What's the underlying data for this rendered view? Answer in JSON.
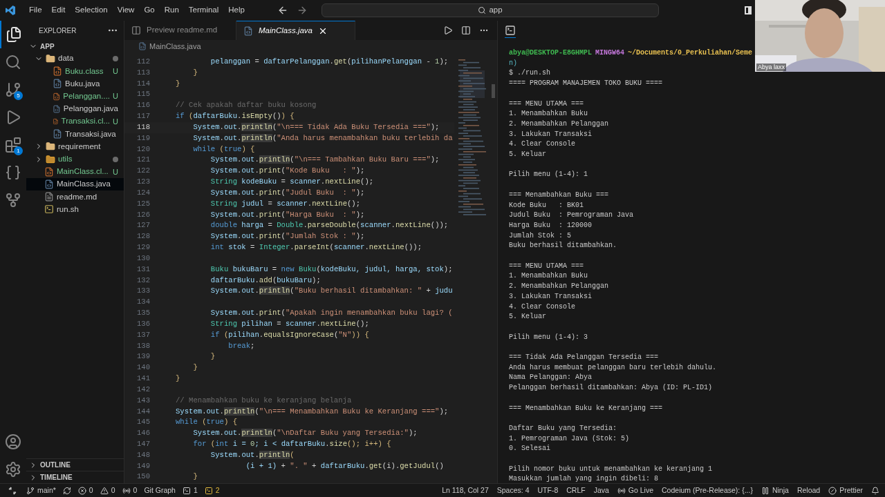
{
  "menu": [
    "File",
    "Edit",
    "Selection",
    "View",
    "Go",
    "Run",
    "Terminal",
    "Help"
  ],
  "search": {
    "value": "app"
  },
  "activity": [
    {
      "kind": "files",
      "selected": true
    },
    {
      "kind": "search",
      "selected": false
    },
    {
      "kind": "scm",
      "selected": false,
      "badge": "5"
    },
    {
      "kind": "debug",
      "selected": false
    },
    {
      "kind": "extensions",
      "selected": false,
      "badge": "1"
    },
    {
      "kind": "braces",
      "selected": false
    },
    {
      "kind": "graph",
      "selected": false
    }
  ],
  "explorer": {
    "title": "EXPLORER",
    "root": "APP",
    "items": [
      {
        "name": "data",
        "kind": "folder",
        "expanded": true,
        "modified": true,
        "untracked": false,
        "selected": false,
        "children": [
          {
            "name": "Buku.class",
            "kind": "class",
            "untracked": true,
            "status": "U",
            "selected": false
          },
          {
            "name": "Buku.java",
            "kind": "java",
            "untracked": false,
            "selected": false
          },
          {
            "name": "Pelanggan....",
            "kind": "class",
            "untracked": true,
            "status": "U",
            "selected": false
          },
          {
            "name": "Pelanggan.java",
            "kind": "java",
            "untracked": false,
            "selected": false
          },
          {
            "name": "Transaksi.cl...",
            "kind": "class",
            "untracked": true,
            "status": "U",
            "selected": false
          },
          {
            "name": "Transaksi.java",
            "kind": "java",
            "untracked": false,
            "selected": false
          }
        ]
      },
      {
        "name": "requirement",
        "kind": "folder",
        "expanded": false,
        "modified": false,
        "untracked": false,
        "selected": false
      },
      {
        "name": "utils",
        "kind": "tools-folder",
        "expanded": false,
        "modified": true,
        "untracked": true,
        "selected": false
      },
      {
        "name": "MainClass.cl...",
        "kind": "class",
        "untracked": true,
        "status": "U",
        "selected": false
      },
      {
        "name": "MainClass.java",
        "kind": "java",
        "untracked": false,
        "selected": true
      },
      {
        "name": "readme.md",
        "kind": "markdown",
        "untracked": false,
        "selected": false
      },
      {
        "name": "run.sh",
        "kind": "shell",
        "untracked": false,
        "selected": false
      }
    ],
    "sections": [
      "OUTLINE",
      "TIMELINE"
    ]
  },
  "tabs": [
    {
      "label": "Preview readme.md",
      "kind": "preview",
      "selected": false
    },
    {
      "label": "MainClass.java",
      "kind": "java",
      "selected": true
    }
  ],
  "breadcrumb": "MainClass.java",
  "code": [
    {
      "n": "112",
      "active": false,
      "t": [
        {
          "text": "        pelanggan",
          "kind": "v"
        },
        {
          "text": " = ",
          "kind": "p"
        },
        {
          "text": "daftarPelanggan",
          "kind": "v"
        },
        {
          "text": ".",
          "kind": "p"
        },
        {
          "text": "get",
          "kind": "f"
        },
        {
          "text": "(",
          "kind": "p"
        },
        {
          "text": "pilihanPelanggan",
          "kind": "v"
        },
        {
          "text": " - ",
          "kind": "p"
        },
        {
          "text": "1",
          "kind": "n"
        },
        {
          "text": ");",
          "kind": "p"
        }
      ]
    },
    {
      "n": "113",
      "active": false,
      "t": [
        {
          "text": "    }",
          "kind": "b"
        }
      ]
    },
    {
      "n": "114",
      "active": false,
      "t": [
        {
          "text": "}",
          "kind": "b"
        }
      ]
    },
    {
      "n": "115",
      "active": false
    },
    {
      "n": "116",
      "active": false,
      "t": [
        {
          "text": "// Cek apakah daftar buku kosong",
          "kind": "m"
        }
      ]
    },
    {
      "n": "117",
      "active": false,
      "t": [
        {
          "text": "if",
          "kind": "k"
        },
        {
          "text": " (",
          "kind": "b"
        },
        {
          "text": "daftarBuku",
          "kind": "v"
        },
        {
          "text": ".",
          "kind": "p"
        },
        {
          "text": "isEmpty",
          "kind": "f"
        },
        {
          "text": "()",
          "kind": "p"
        },
        {
          "text": ") {",
          "kind": "b"
        }
      ]
    },
    {
      "n": "118",
      "active": true,
      "t": [
        {
          "text": "    System",
          "kind": "v"
        },
        {
          "text": ".",
          "kind": "p"
        },
        {
          "text": "out",
          "kind": "v"
        },
        {
          "text": ".",
          "kind": "p"
        },
        {
          "text": "println",
          "kind": "h"
        },
        {
          "text": "(",
          "kind": "p"
        },
        {
          "text": "\"\\n=== Tidak Ada Buku Tersedia ===\"",
          "kind": "s"
        },
        {
          "text": ");",
          "kind": "p"
        }
      ]
    },
    {
      "n": "119",
      "active": false,
      "t": [
        {
          "text": "    System",
          "kind": "v"
        },
        {
          "text": ".",
          "kind": "p"
        },
        {
          "text": "out",
          "kind": "v"
        },
        {
          "text": ".",
          "kind": "p"
        },
        {
          "text": "println",
          "kind": "h"
        },
        {
          "text": "(",
          "kind": "p"
        },
        {
          "text": "\"Anda harus menambahkan buku terlebih da",
          "kind": "s"
        }
      ]
    },
    {
      "n": "120",
      "active": false,
      "t": [
        {
          "text": "    while",
          "kind": "k"
        },
        {
          "text": " (",
          "kind": "b"
        },
        {
          "text": "true",
          "kind": "k"
        },
        {
          "text": ") {",
          "kind": "b"
        }
      ]
    },
    {
      "n": "121",
      "active": false,
      "t": [
        {
          "text": "        System",
          "kind": "v"
        },
        {
          "text": ".",
          "kind": "p"
        },
        {
          "text": "out",
          "kind": "v"
        },
        {
          "text": ".",
          "kind": "p"
        },
        {
          "text": "println",
          "kind": "h"
        },
        {
          "text": "(",
          "kind": "p"
        },
        {
          "text": "\"\\n=== Tambahkan Buku Baru ===\"",
          "kind": "s"
        },
        {
          "text": ");",
          "kind": "p"
        }
      ]
    },
    {
      "n": "122",
      "active": false,
      "t": [
        {
          "text": "        System",
          "kind": "v"
        },
        {
          "text": ".",
          "kind": "p"
        },
        {
          "text": "out",
          "kind": "v"
        },
        {
          "text": ".",
          "kind": "p"
        },
        {
          "text": "print",
          "kind": "f"
        },
        {
          "text": "(",
          "kind": "p"
        },
        {
          "text": "\"Kode Buku   : \"",
          "kind": "s"
        },
        {
          "text": ");",
          "kind": "p"
        }
      ]
    },
    {
      "n": "123",
      "active": false,
      "t": [
        {
          "text": "        String",
          "kind": "t"
        },
        {
          "text": " kodeBuku",
          "kind": "v"
        },
        {
          "text": " = ",
          "kind": "p"
        },
        {
          "text": "scanner",
          "kind": "v"
        },
        {
          "text": ".",
          "kind": "p"
        },
        {
          "text": "nextLine",
          "kind": "f"
        },
        {
          "text": "();",
          "kind": "p"
        }
      ]
    },
    {
      "n": "124",
      "active": false,
      "t": [
        {
          "text": "        System",
          "kind": "v"
        },
        {
          "text": ".",
          "kind": "p"
        },
        {
          "text": "out",
          "kind": "v"
        },
        {
          "text": ".",
          "kind": "p"
        },
        {
          "text": "print",
          "kind": "f"
        },
        {
          "text": "(",
          "kind": "p"
        },
        {
          "text": "\"Judul Buku  : \"",
          "kind": "s"
        },
        {
          "text": ");",
          "kind": "p"
        }
      ]
    },
    {
      "n": "125",
      "active": false,
      "t": [
        {
          "text": "        String",
          "kind": "t"
        },
        {
          "text": " judul",
          "kind": "v"
        },
        {
          "text": " = ",
          "kind": "p"
        },
        {
          "text": "scanner",
          "kind": "v"
        },
        {
          "text": ".",
          "kind": "p"
        },
        {
          "text": "nextLine",
          "kind": "f"
        },
        {
          "text": "();",
          "kind": "p"
        }
      ]
    },
    {
      "n": "126",
      "active": false,
      "t": [
        {
          "text": "        System",
          "kind": "v"
        },
        {
          "text": ".",
          "kind": "p"
        },
        {
          "text": "out",
          "kind": "v"
        },
        {
          "text": ".",
          "kind": "p"
        },
        {
          "text": "print",
          "kind": "f"
        },
        {
          "text": "(",
          "kind": "p"
        },
        {
          "text": "\"Harga Buku  : \"",
          "kind": "s"
        },
        {
          "text": ");",
          "kind": "p"
        }
      ]
    },
    {
      "n": "127",
      "active": false,
      "t": [
        {
          "text": "        double",
          "kind": "k"
        },
        {
          "text": " harga",
          "kind": "v"
        },
        {
          "text": " = ",
          "kind": "p"
        },
        {
          "text": "Double",
          "kind": "t"
        },
        {
          "text": ".",
          "kind": "p"
        },
        {
          "text": "parseDouble",
          "kind": "f"
        },
        {
          "text": "(",
          "kind": "p"
        },
        {
          "text": "scanner",
          "kind": "v"
        },
        {
          "text": ".",
          "kind": "p"
        },
        {
          "text": "nextLine",
          "kind": "f"
        },
        {
          "text": "());",
          "kind": "p"
        }
      ]
    },
    {
      "n": "128",
      "active": false,
      "t": [
        {
          "text": "        System",
          "kind": "v"
        },
        {
          "text": ".",
          "kind": "p"
        },
        {
          "text": "out",
          "kind": "v"
        },
        {
          "text": ".",
          "kind": "p"
        },
        {
          "text": "print",
          "kind": "f"
        },
        {
          "text": "(",
          "kind": "p"
        },
        {
          "text": "\"Jumlah Stok : \"",
          "kind": "s"
        },
        {
          "text": ");",
          "kind": "p"
        }
      ]
    },
    {
      "n": "129",
      "active": false,
      "t": [
        {
          "text": "        int",
          "kind": "k"
        },
        {
          "text": " stok",
          "kind": "v"
        },
        {
          "text": " = ",
          "kind": "p"
        },
        {
          "text": "Integer",
          "kind": "t"
        },
        {
          "text": ".",
          "kind": "p"
        },
        {
          "text": "parseInt",
          "kind": "f"
        },
        {
          "text": "(",
          "kind": "p"
        },
        {
          "text": "scanner",
          "kind": "v"
        },
        {
          "text": ".",
          "kind": "p"
        },
        {
          "text": "nextLine",
          "kind": "f"
        },
        {
          "text": "());",
          "kind": "p"
        }
      ]
    },
    {
      "n": "130",
      "active": false
    },
    {
      "n": "131",
      "active": false,
      "t": [
        {
          "text": "        Buku",
          "kind": "t"
        },
        {
          "text": " bukuBaru",
          "kind": "v"
        },
        {
          "text": " = ",
          "kind": "p"
        },
        {
          "text": "new",
          "kind": "k"
        },
        {
          "text": " Buku",
          "kind": "t"
        },
        {
          "text": "(",
          "kind": "p"
        },
        {
          "text": "kodeBuku, judul, harga, stok",
          "kind": "v"
        },
        {
          "text": ");",
          "kind": "p"
        }
      ]
    },
    {
      "n": "132",
      "active": false,
      "t": [
        {
          "text": "        daftarBuku",
          "kind": "v"
        },
        {
          "text": ".",
          "kind": "p"
        },
        {
          "text": "add",
          "kind": "f"
        },
        {
          "text": "(",
          "kind": "p"
        },
        {
          "text": "bukuBaru",
          "kind": "v"
        },
        {
          "text": ");",
          "kind": "p"
        }
      ]
    },
    {
      "n": "133",
      "active": false,
      "t": [
        {
          "text": "        System",
          "kind": "v"
        },
        {
          "text": ".",
          "kind": "p"
        },
        {
          "text": "out",
          "kind": "v"
        },
        {
          "text": ".",
          "kind": "p"
        },
        {
          "text": "println",
          "kind": "h"
        },
        {
          "text": "(",
          "kind": "p"
        },
        {
          "text": "\"Buku berhasil ditambahkan: \"",
          "kind": "s"
        },
        {
          "text": " + ",
          "kind": "p"
        },
        {
          "text": "judu",
          "kind": "v"
        }
      ]
    },
    {
      "n": "134",
      "active": false
    },
    {
      "n": "135",
      "active": false,
      "t": [
        {
          "text": "        System",
          "kind": "v"
        },
        {
          "text": ".",
          "kind": "p"
        },
        {
          "text": "out",
          "kind": "v"
        },
        {
          "text": ".",
          "kind": "p"
        },
        {
          "text": "print",
          "kind": "f"
        },
        {
          "text": "(",
          "kind": "p"
        },
        {
          "text": "\"Apakah ingin menambahkan buku lagi? (",
          "kind": "s"
        }
      ]
    },
    {
      "n": "136",
      "active": false,
      "t": [
        {
          "text": "        String",
          "kind": "t"
        },
        {
          "text": " pilihan",
          "kind": "v"
        },
        {
          "text": " = ",
          "kind": "p"
        },
        {
          "text": "scanner",
          "kind": "v"
        },
        {
          "text": ".",
          "kind": "p"
        },
        {
          "text": "nextLine",
          "kind": "f"
        },
        {
          "text": "();",
          "kind": "p"
        }
      ]
    },
    {
      "n": "137",
      "active": false,
      "t": [
        {
          "text": "        if",
          "kind": "k"
        },
        {
          "text": " (",
          "kind": "b"
        },
        {
          "text": "pilihan",
          "kind": "v"
        },
        {
          "text": ".",
          "kind": "p"
        },
        {
          "text": "equalsIgnoreCase",
          "kind": "f"
        },
        {
          "text": "(",
          "kind": "p"
        },
        {
          "text": "\"N\"",
          "kind": "s"
        },
        {
          "text": ")) {",
          "kind": "b"
        }
      ]
    },
    {
      "n": "138",
      "active": false,
      "t": [
        {
          "text": "            break",
          "kind": "k"
        },
        {
          "text": ";",
          "kind": "p"
        }
      ]
    },
    {
      "n": "139",
      "active": false,
      "t": [
        {
          "text": "        }",
          "kind": "b"
        }
      ]
    },
    {
      "n": "140",
      "active": false,
      "t": [
        {
          "text": "    }",
          "kind": "b"
        }
      ]
    },
    {
      "n": "141",
      "active": false,
      "t": [
        {
          "text": "}",
          "kind": "b"
        }
      ]
    },
    {
      "n": "142",
      "active": false
    },
    {
      "n": "143",
      "active": false,
      "t": [
        {
          "text": "// Menambahkan buku ke keranjang belanja",
          "kind": "m"
        }
      ]
    },
    {
      "n": "144",
      "active": false,
      "t": [
        {
          "text": "System",
          "kind": "v"
        },
        {
          "text": ".",
          "kind": "p"
        },
        {
          "text": "out",
          "kind": "v"
        },
        {
          "text": ".",
          "kind": "p"
        },
        {
          "text": "println",
          "kind": "h"
        },
        {
          "text": "(",
          "kind": "p"
        },
        {
          "text": "\"\\n=== Menambahkan Buku ke Keranjang ===\"",
          "kind": "s"
        },
        {
          "text": ");",
          "kind": "p"
        }
      ]
    },
    {
      "n": "145",
      "active": false,
      "t": [
        {
          "text": "while",
          "kind": "k"
        },
        {
          "text": " (",
          "kind": "b"
        },
        {
          "text": "true",
          "kind": "k"
        },
        {
          "text": ") {",
          "kind": "b"
        }
      ]
    },
    {
      "n": "146",
      "active": false,
      "t": [
        {
          "text": "    System",
          "kind": "v"
        },
        {
          "text": ".",
          "kind": "p"
        },
        {
          "text": "out",
          "kind": "v"
        },
        {
          "text": ".",
          "kind": "p"
        },
        {
          "text": "println",
          "kind": "h"
        },
        {
          "text": "(",
          "kind": "p"
        },
        {
          "text": "\"\\nDaftar Buku yang Tersedia:\"",
          "kind": "s"
        },
        {
          "text": ");",
          "kind": "p"
        }
      ]
    },
    {
      "n": "147",
      "active": false,
      "t": [
        {
          "text": "    for",
          "kind": "k"
        },
        {
          "text": " (",
          "kind": "b"
        },
        {
          "text": "int",
          "kind": "k"
        },
        {
          "text": " i = ",
          "kind": "v"
        },
        {
          "text": "0",
          "kind": "n"
        },
        {
          "text": "; i < ",
          "kind": "v"
        },
        {
          "text": "daftarBuku",
          "kind": "v"
        },
        {
          "text": ".",
          "kind": "p"
        },
        {
          "text": "size",
          "kind": "f"
        },
        {
          "text": "(); i++) {",
          "kind": "b"
        }
      ]
    },
    {
      "n": "148",
      "active": false,
      "t": [
        {
          "text": "        System",
          "kind": "v"
        },
        {
          "text": ".",
          "kind": "p"
        },
        {
          "text": "out",
          "kind": "v"
        },
        {
          "text": ".",
          "kind": "p"
        },
        {
          "text": "println",
          "kind": "h"
        },
        {
          "text": "(",
          "kind": "b"
        }
      ]
    },
    {
      "n": "149",
      "active": false,
      "t": [
        {
          "text": "                (i + 1)",
          "kind": "v"
        },
        {
          "text": " + ",
          "kind": "p"
        },
        {
          "text": "\". \"",
          "kind": "s"
        },
        {
          "text": " + ",
          "kind": "p"
        },
        {
          "text": "daftarBuku",
          "kind": "v"
        },
        {
          "text": ".",
          "kind": "p"
        },
        {
          "text": "get",
          "kind": "f"
        },
        {
          "text": "(i).",
          "kind": "p"
        },
        {
          "text": "getJudul",
          "kind": "f"
        },
        {
          "text": "()",
          "kind": "p"
        }
      ]
    },
    {
      "n": "150",
      "active": false,
      "t": [
        {
          "text": "    }",
          "kind": "b"
        }
      ]
    }
  ],
  "terminal": {
    "prompt": [
      {
        "text": "abya@DESKTOP-E8GHMPL",
        "color": "#3fb950"
      },
      {
        "text": "MINGW64",
        "color": "#c678dd"
      },
      {
        "text": "~/Documents/0_Perkuliahan/Seme",
        "color": "#e8c050"
      }
    ],
    "prompt_wrap": "n)",
    "command": "$ ./run.sh",
    "blocks": [
      [
        "==== PROGRAM MANAJEMEN TOKO BUKU ===="
      ],
      [
        "=== MENU UTAMA ===",
        "1. Menambahkan Buku",
        "2. Menambahkan Pelanggan",
        "3. Lakukan Transaksi",
        "4. Clear Console",
        "5. Keluar"
      ],
      [
        "Pilih menu (1-4): 1"
      ],
      [
        "=== Menambahkan Buku ===",
        "Kode Buku   : BK01",
        "Judul Buku  : Pemrograman Java",
        "Harga Buku  : 120000",
        "Jumlah Stok : 5",
        "Buku berhasil ditambahkan."
      ],
      [
        "=== MENU UTAMA ===",
        "1. Menambahkan Buku",
        "2. Menambahkan Pelanggan",
        "3. Lakukan Transaksi",
        "4. Clear Console",
        "5. Keluar"
      ],
      [
        "Pilih menu (1-4): 3"
      ],
      [
        "=== Tidak Ada Pelanggan Tersedia ===",
        "Anda harus membuat pelanggan baru terlebih dahulu.",
        "Nama Pelanggan: Abya",
        "Pelanggan berhasil ditambahkan: Abya (ID: PL-ID1)"
      ],
      [
        "=== Menambahkan Buku ke Keranjang ==="
      ],
      [
        "Daftar Buku yang Tersedia:",
        "1. Pemrograman Java (Stok: 5)",
        "0. Selesai"
      ],
      [
        "Pilih nomor buku untuk menambahkan ke keranjang 1",
        "Masukkan jumlah yang ingin dibeli: 8"
      ]
    ]
  },
  "webcam": {
    "name": "Abya laxx"
  },
  "status_left": [
    {
      "kind": "remote"
    },
    {
      "kind": "branch",
      "text": "main*"
    },
    {
      "kind": "sync"
    },
    {
      "kind": "errors",
      "text": "0"
    },
    {
      "kind": "warnings",
      "text": "0"
    },
    {
      "kind": "ports",
      "text": "0"
    },
    {
      "kind": "text",
      "text": "Git Graph"
    },
    {
      "kind": "terminal",
      "text": "1",
      "highlight": false
    },
    {
      "kind": "terminal",
      "text": "2",
      "highlight": true
    }
  ],
  "status_right": [
    {
      "kind": "text",
      "text": "Ln 118, Col 27"
    },
    {
      "kind": "text",
      "text": "Spaces: 4"
    },
    {
      "kind": "text",
      "text": "UTF-8"
    },
    {
      "kind": "text",
      "text": "CRLF"
    },
    {
      "kind": "text",
      "text": "Java"
    },
    {
      "kind": "live",
      "text": "Go Live"
    },
    {
      "kind": "text",
      "text": "Codeium (Pre-Release): {...}"
    },
    {
      "kind": "ninja",
      "text": "Ninja"
    },
    {
      "kind": "text",
      "text": "Reload"
    },
    {
      "kind": "prettier",
      "text": "Prettier"
    },
    {
      "kind": "bell"
    }
  ]
}
